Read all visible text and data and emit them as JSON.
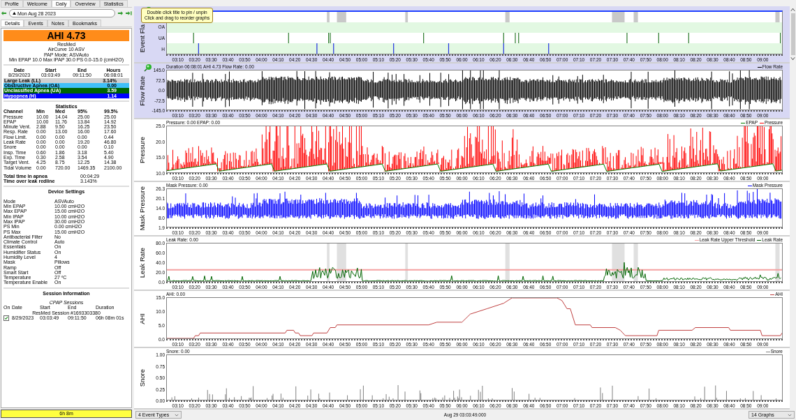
{
  "main_tabs": [
    {
      "label": "Profile",
      "selected": false
    },
    {
      "label": "Welcome",
      "selected": false
    },
    {
      "label": "Daily",
      "selected": true
    },
    {
      "label": "Overview",
      "selected": false
    },
    {
      "label": "Statistics",
      "selected": false
    }
  ],
  "date_nav": {
    "date": "Mon Aug 28 2023"
  },
  "detail_tabs": [
    {
      "label": "Details",
      "selected": true
    },
    {
      "label": "Events",
      "selected": false
    },
    {
      "label": "Notes",
      "selected": false
    },
    {
      "label": "Bookmarks",
      "selected": false
    }
  ],
  "summary": {
    "ahi": "AHI 4.73",
    "brand": "ResMed",
    "model": "AirCurve 10 ASV",
    "mode": "PAP Mode: ASVAuto",
    "pressure": "Min EPAP 10.0 Max IPAP 30.0 PS 0.0-15.0 (cmH2O)"
  },
  "day": {
    "columns": [
      "Date",
      "Start",
      "End",
      "Hours"
    ],
    "values": [
      "8/29/2023",
      "03:03:49",
      "09:11:50",
      "06:08:01"
    ]
  },
  "event_indices": [
    {
      "label": "Large Leak (LL)",
      "value": "3.14%",
      "color": "#d0d0d0"
    },
    {
      "label": "Obstructive Apnea (OA)",
      "value": "0.00",
      "color": "#40c0f8"
    },
    {
      "label": "Unclassified Apnea (UA)",
      "value": "3.59",
      "color": "#006400"
    },
    {
      "label": "Hypopnea (H)",
      "value": "1.14",
      "color": "#0000ff"
    }
  ],
  "statistics": {
    "title": "Statistics",
    "columns": [
      "Channel",
      "Min",
      "Med",
      "95%",
      "99.5%"
    ],
    "rows": [
      [
        "Pressure",
        "10.00",
        "14.04",
        "25.00",
        "25.00"
      ],
      [
        "EPAP",
        "10.00",
        "11.76",
        "13.84",
        "14.92"
      ],
      [
        "Minute Vent.",
        "2.88",
        "9.50",
        "16.25",
        "23.50"
      ],
      [
        "Resp. Rate",
        "0.00",
        "13.00",
        "16.00",
        "17.60"
      ],
      [
        "Flow Limit.",
        "0.00",
        "0.00",
        "0.00",
        "0.44"
      ],
      [
        "Leak Rate",
        "0.00",
        "0.00",
        "19.20",
        "46.80"
      ],
      [
        "Snore",
        "0.00",
        "0.00",
        "0.00",
        "0.10"
      ],
      [
        "Insp. Time",
        "0.60",
        "1.86",
        "3.18",
        "5.40"
      ],
      [
        "Exp. Time",
        "0.30",
        "2.58",
        "3.54",
        "4.90"
      ],
      [
        "Target Vent.",
        "4.25",
        "8.75",
        "12.25",
        "14.38"
      ],
      [
        "Tidal Volume",
        "0.00",
        "720.00",
        "1469.35",
        "2100.00"
      ]
    ]
  },
  "totals": [
    {
      "label": "Total time in apnea",
      "value": "00:04:29"
    },
    {
      "label": "Time over leak redline",
      "value": "3.143%"
    }
  ],
  "device_settings": {
    "title": "Device Settings",
    "rows": [
      [
        "Mode",
        "ASVAuto"
      ],
      [
        "Min EPAP",
        "10.00 cmH2O"
      ],
      [
        "Max EPAP",
        "15.00 cmH2O"
      ],
      [
        "Min IPAP",
        "10.00 cmH2O"
      ],
      [
        "Max IPAP",
        "30.00 cmH2O"
      ],
      [
        "PS Min",
        "0.00 cmH2O"
      ],
      [
        "PS Max",
        "15.00 cmH2O"
      ],
      [
        "Antibacterial Filter",
        "No"
      ],
      [
        "Climate Control",
        "Auto"
      ],
      [
        "Essentials",
        "On"
      ],
      [
        "Humidifier Status",
        "On"
      ],
      [
        "Humidity Level",
        "4"
      ],
      [
        "Mask",
        "Pillows"
      ],
      [
        "Ramp",
        "Off"
      ],
      [
        "Smart Start",
        "Off"
      ],
      [
        "Temperature",
        "27 ºC"
      ],
      [
        "Temperature Enable",
        "On"
      ]
    ]
  },
  "sessions": {
    "title": "Session Information",
    "group": "CPAP Sessions",
    "columns": [
      "On",
      "Date",
      "Start",
      "End",
      "Duration"
    ],
    "session_name": "ResMed Session #1693303380",
    "rows": [
      {
        "checked": true,
        "date": "8/29/2023",
        "start": "03:03:49",
        "end": "09:11:50",
        "duration": "06h 08m 01s"
      }
    ]
  },
  "usage_bar": {
    "label": "6h 8m"
  },
  "tooltip": "Double click title to pin / unpin\nClick and drag to reorder graphs",
  "graphs": [
    {
      "kind": "events",
      "ylabel": "Event Fla",
      "pinned": true,
      "rows": [
        {
          "kind": "span"
        },
        {
          "kind": "flag",
          "label": "OA"
        },
        {
          "kind": "flag",
          "label": "UA"
        },
        {
          "kind": "flag",
          "label": "H"
        }
      ],
      "x_ticks": [
        "03:10",
        "03:20",
        "03:30",
        "03:40",
        "03:50",
        "04:00",
        "04:10",
        "04:20",
        "04:30",
        "04:40",
        "04:50",
        "05:00",
        "05:10",
        "05:20",
        "05:30",
        "05:40",
        "05:50",
        "06:00",
        "06:10",
        "06:20",
        "06:30",
        "06:40",
        "06:50",
        "07:00",
        "07:10",
        "07:20",
        "07:30",
        "07:40",
        "07:50",
        "08:00",
        "08:10",
        "08:20",
        "08:30",
        "08:40",
        "08:50",
        "09:00"
      ]
    },
    {
      "kind": "flow",
      "ylabel": "Flow Rate",
      "pinned": true,
      "header": "Duration 06:08:01 AHI 4.73 Flow Rate: 0.00",
      "legend": [
        {
          "label": "Flow Rate",
          "color": "#000000"
        }
      ],
      "y_ticks": [
        "145.0",
        "72.5",
        "0.0",
        "-72.5",
        "-145.0"
      ],
      "x_ticks": [
        "03:10",
        "03:20",
        "03:30",
        "03:40",
        "03:50",
        "04:00",
        "04:10",
        "04:20",
        "04:30",
        "04:40",
        "04:50",
        "05:00",
        "05:10",
        "05:20",
        "05:30",
        "05:40",
        "05:50",
        "06:00",
        "06:10",
        "06:20",
        "06:30",
        "06:40",
        "06:50",
        "07:00",
        "07:10",
        "07:20",
        "07:30",
        "07:40",
        "07:50",
        "08:00",
        "08:10",
        "08:20",
        "08:30",
        "08:40",
        "08:50",
        "09:00"
      ]
    },
    {
      "kind": "pressure",
      "ylabel": "Pressure",
      "pinned": false,
      "header": "Pressure: 0.00 EPAP: 0.00",
      "legend": [
        {
          "label": "EPAP",
          "color": "#008000"
        },
        {
          "label": "Pressure",
          "color": "#ff0000"
        }
      ],
      "y_ticks": [
        "25.0",
        "20.0",
        "15.0",
        "10.0"
      ],
      "x_ticks": [
        "03:10",
        "03:20",
        "03:30",
        "03:40",
        "03:50",
        "04:00",
        "04:10",
        "04:20",
        "04:30",
        "04:40",
        "04:50",
        "05:00",
        "05:10",
        "05:20",
        "05:30",
        "05:40",
        "05:50",
        "06:00",
        "06:10",
        "06:20",
        "06:30",
        "06:40",
        "06:50",
        "07:00",
        "07:10",
        "07:20",
        "07:30",
        "07:40",
        "07:50",
        "08:00",
        "08:10",
        "08:20",
        "08:30",
        "08:40",
        "08:50",
        "09:00"
      ]
    },
    {
      "kind": "mask",
      "ylabel": "Mask Pressure",
      "pinned": false,
      "header": "Mask Pressure: 0.00",
      "legend": [
        {
          "label": "Mask Pressure",
          "color": "#0000ff"
        }
      ],
      "y_ticks": [
        "26.3",
        "20.1",
        "14.0",
        "8.0",
        "1.9"
      ],
      "x_ticks": [
        "03:10",
        "03:20",
        "03:30",
        "03:40",
        "03:50",
        "04:00",
        "04:10",
        "04:20",
        "04:30",
        "04:40",
        "04:50",
        "05:00",
        "05:10",
        "05:20",
        "05:30",
        "05:40",
        "05:50",
        "06:00",
        "06:10",
        "06:20",
        "06:30",
        "06:40",
        "06:50",
        "07:00",
        "07:10",
        "07:20",
        "07:30",
        "07:40",
        "07:50",
        "08:00",
        "08:10",
        "08:20",
        "08:30",
        "08:40",
        "08:50",
        "09:00"
      ]
    },
    {
      "kind": "leak",
      "ylabel": "Leak Rate",
      "pinned": false,
      "header": "Leak Rate: 0.00",
      "legend": [
        {
          "label": "Leak Rate Upper Threshold",
          "color": "#f4a0a0"
        },
        {
          "label": "Leak Rate",
          "color": "#006400"
        }
      ],
      "y_ticks": [
        "80.0",
        "60.0",
        "40.0",
        "20.0",
        "0.0"
      ],
      "x_ticks": [
        "03:10",
        "03:20",
        "03:30",
        "03:40",
        "03:50",
        "04:00",
        "04:10",
        "04:20",
        "04:30",
        "04:40",
        "04:50",
        "05:00",
        "05:10",
        "05:20",
        "05:30",
        "05:40",
        "05:50",
        "06:00",
        "06:10",
        "06:20",
        "06:30",
        "06:40",
        "06:50",
        "07:00",
        "07:10",
        "07:20",
        "07:30",
        "07:40",
        "07:50",
        "08:00",
        "08:10",
        "08:20",
        "08:30",
        "08:40",
        "08:50",
        "09:00"
      ]
    },
    {
      "kind": "ahi",
      "ylabel": "AHI",
      "pinned": false,
      "header": "AHI: 0.00",
      "legend": [
        {
          "label": "AHI",
          "color": "#c04040"
        }
      ],
      "y_ticks": [
        "15.0",
        "10.0",
        "5.0",
        "0.0"
      ],
      "x_ticks": [
        "03:10",
        "03:20",
        "03:30",
        "03:40",
        "03:50",
        "04:00",
        "04:10",
        "04:20",
        "04:30",
        "04:40",
        "04:50",
        "05:00",
        "05:10",
        "05:20",
        "05:30",
        "05:40",
        "05:50",
        "06:00",
        "06:10",
        "06:20",
        "06:30",
        "06:40",
        "06:50",
        "07:00",
        "07:10",
        "07:20",
        "07:30",
        "07:40",
        "07:50",
        "08:00",
        "08:10",
        "08:20",
        "08:30",
        "08:40",
        "08:50",
        "09:00"
      ]
    },
    {
      "kind": "snore",
      "ylabel": "Snore",
      "pinned": false,
      "header": "Snore: 0.00",
      "legend": [
        {
          "label": "Snore",
          "color": "#808080"
        }
      ],
      "y_ticks": [
        "1.00",
        "0.75",
        "0.50",
        "0.25",
        "0.00"
      ],
      "x_ticks": [
        "03:10",
        "03:20",
        "03:30",
        "03:40",
        "03:50",
        "04:00",
        "04:10",
        "04:20",
        "04:30",
        "04:40",
        "04:50",
        "05:00",
        "05:10",
        "05:20",
        "05:30",
        "05:40",
        "05:50",
        "06:00",
        "06:10",
        "06:20",
        "06:30",
        "06:40",
        "06:50",
        "07:00",
        "07:10",
        "07:20",
        "07:30",
        "07:40",
        "07:50",
        "08:00",
        "08:10",
        "08:20",
        "08:30",
        "08:40",
        "08:50",
        "09:00"
      ]
    }
  ],
  "bottom_bar": {
    "event_types": "4 Event Types",
    "time": "Aug 29 03:03:49.000",
    "graph_count": "14 Graphs"
  }
}
